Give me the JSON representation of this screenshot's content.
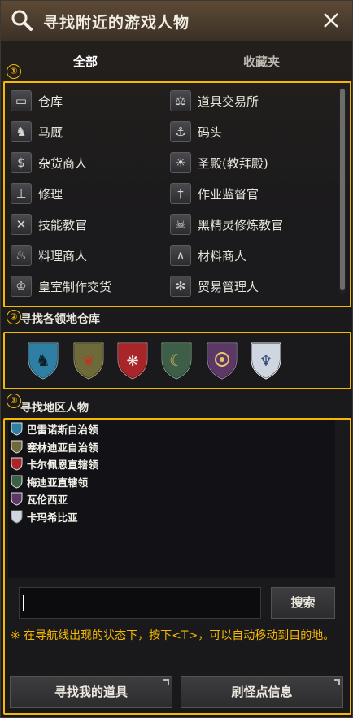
{
  "window": {
    "title": "寻找附近的游戏人物"
  },
  "tabs": [
    {
      "label": "全部",
      "active": true
    },
    {
      "label": "收藏夹",
      "active": false
    }
  ],
  "markers": [
    "①",
    "②",
    "③"
  ],
  "npc_types": [
    {
      "label": "仓库",
      "icon": "chest-icon"
    },
    {
      "label": "道具交易所",
      "icon": "scales-icon"
    },
    {
      "label": "马厩",
      "icon": "horse-icon"
    },
    {
      "label": "码头",
      "icon": "anchor-icon"
    },
    {
      "label": "杂货商人",
      "icon": "money-bag-icon"
    },
    {
      "label": "圣殿(教拜殿)",
      "icon": "sun-emblem-icon"
    },
    {
      "label": "修理",
      "icon": "anvil-icon"
    },
    {
      "label": "作业监督官",
      "icon": "pickaxe-icon"
    },
    {
      "label": "技能教官",
      "icon": "crossed-weapons-icon"
    },
    {
      "label": "黑精灵修炼教官",
      "icon": "dark-spirit-icon"
    },
    {
      "label": "料理商人",
      "icon": "roast-chicken-icon"
    },
    {
      "label": "材料商人",
      "icon": "material-icon"
    },
    {
      "label": "皇室制作交货",
      "icon": "royal-crafter-icon"
    },
    {
      "label": "贸易管理人",
      "icon": "trade-wheel-icon"
    }
  ],
  "territory_section": {
    "title": "寻找各领地仓库"
  },
  "territories": [
    {
      "name": "balenos-shield",
      "color": "#2f7fa5",
      "emblem": "horse"
    },
    {
      "name": "serendia-shield",
      "color": "#6e6a3a",
      "emblem": "griffin"
    },
    {
      "name": "calpheon-shield",
      "color": "#a8252a",
      "emblem": "eagle"
    },
    {
      "name": "mediah-shield",
      "color": "#3d5e47",
      "emblem": "moon"
    },
    {
      "name": "valencia-shield",
      "color": "#5b3866",
      "emblem": "eye"
    },
    {
      "name": "kamasylvia-shield",
      "color": "#cfd6e2",
      "emblem": "tree"
    }
  ],
  "region_section": {
    "title": "寻找地区人物"
  },
  "regions": [
    {
      "name": "巴雷诺斯自治领",
      "color": "#2f7fa5"
    },
    {
      "name": "塞林迪亚自治领",
      "color": "#6e6a3a"
    },
    {
      "name": "卡尔佩恩直辖领",
      "color": "#a8252a"
    },
    {
      "name": "梅迪亚直辖领",
      "color": "#3d5e47"
    },
    {
      "name": "瓦伦西亚",
      "color": "#5b3866"
    },
    {
      "name": "卡玛希比亚",
      "color": "#cfd6e2"
    }
  ],
  "search": {
    "value": "",
    "placeholder": "",
    "button_label": "搜索"
  },
  "hint": "※ 在导航线出现的状态下，按下<T>，可以自动移动到目的地。",
  "footer": {
    "find_items_label": "寻找我的道具",
    "monster_zone_label": "刷怪点信息"
  },
  "colors": {
    "accent": "#f6b800"
  }
}
